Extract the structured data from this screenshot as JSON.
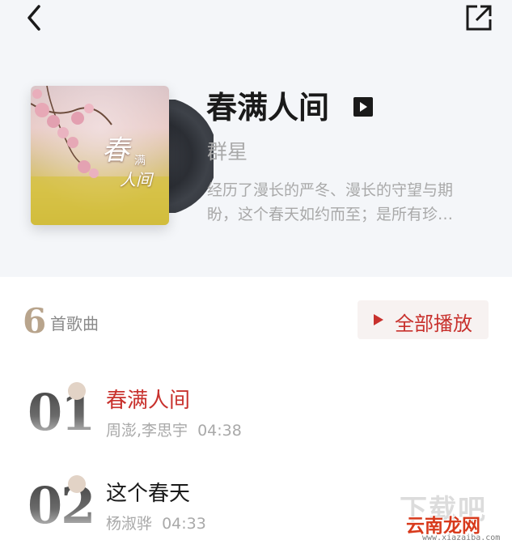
{
  "header": {
    "back_icon": "chevron-left-icon",
    "share_icon": "external-share-icon"
  },
  "album": {
    "cover_art_lines": [
      "春",
      "满",
      "人间"
    ],
    "title": "春满人间",
    "title_icon": "play-square-icon",
    "artist": "群星",
    "description": "经历了漫长的严冬、漫长的守望与期盼，这个春天如约而至；是所有珍…"
  },
  "songs_summary": {
    "count": "6",
    "count_label": "首歌曲",
    "play_all_label": "全部播放",
    "play_all_icon": "play-triangle-icon"
  },
  "tracks": [
    {
      "number": "01",
      "title": "春满人间",
      "artists": "周澎,李思宇",
      "duration": "04:38",
      "active": true
    },
    {
      "number": "02",
      "title": "这个春天",
      "artists": "杨淑骅",
      "duration": "04:33",
      "active": false
    }
  ],
  "watermark": {
    "big_text": "下载吧",
    "brand": "云南龙网",
    "url": "www.xiazaiba.com"
  },
  "colors": {
    "accent_red": "#c8312d",
    "header_bg": "#f4f6f9",
    "count_gold": "#b8a48c"
  }
}
